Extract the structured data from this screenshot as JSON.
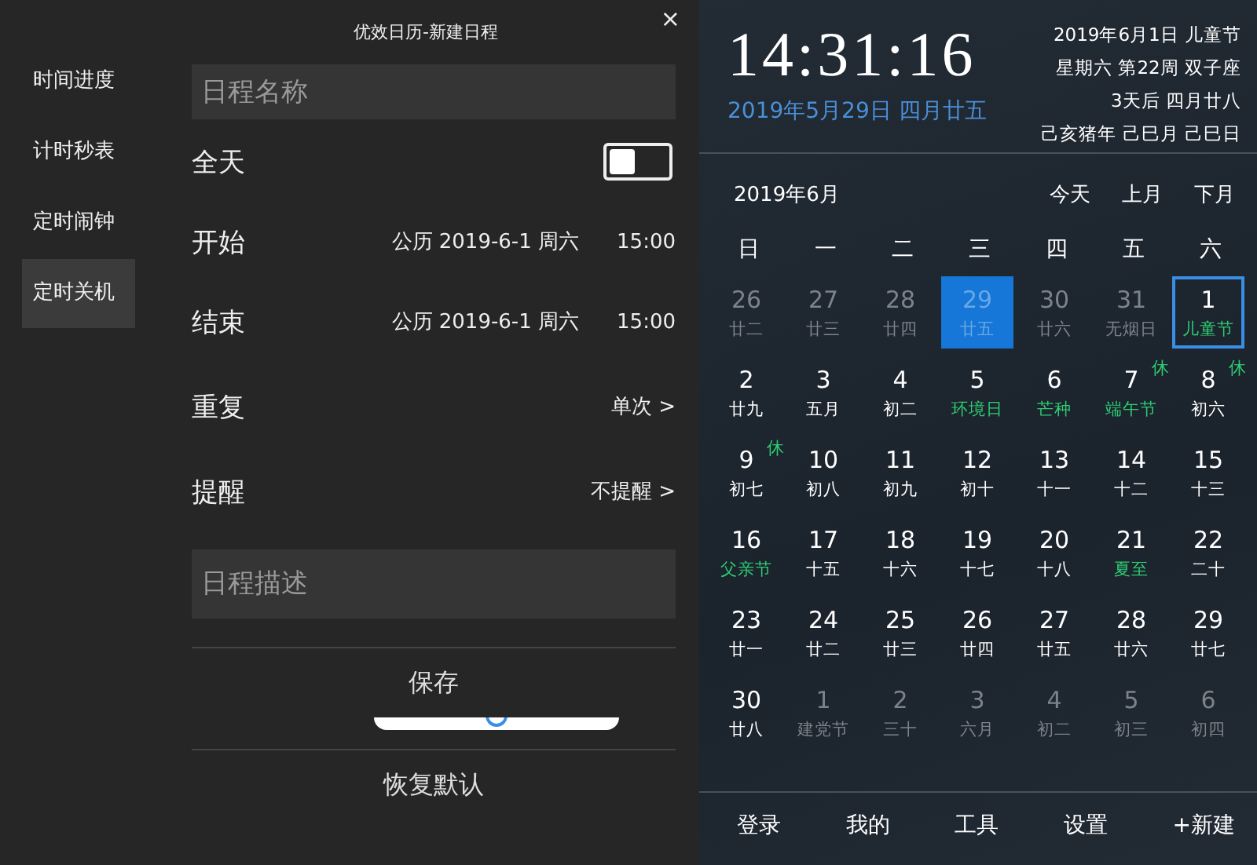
{
  "dialog": {
    "title": "优效日历-新建日程",
    "close": "×",
    "name_field": {
      "placeholder": "日程名称"
    },
    "all_day": {
      "label": "全天",
      "on": false
    },
    "rows": [
      {
        "label": "开始",
        "value": "公历 2019-6-1 周六",
        "time": "15:00"
      },
      {
        "label": "结束",
        "value": "公历 2019-6-1 周六",
        "time": "15:00"
      },
      {
        "label": "重复",
        "value": "单次 >"
      },
      {
        "label": "提醒",
        "value": "不提醒 >"
      }
    ],
    "description_field": {
      "placeholder": "日程描述"
    },
    "save": "保存",
    "slider": {
      "level": 0.5
    },
    "reset": "恢复默认"
  },
  "sidebar": {
    "items": [
      {
        "label": "时间进度",
        "selected": false
      },
      {
        "label": "计时秒表",
        "selected": false
      },
      {
        "label": "定时闹钟",
        "selected": false
      },
      {
        "label": "定时关机",
        "selected": true
      }
    ]
  },
  "calendar": {
    "clock": "14:31:16",
    "lunar_date": "2019年5月29日 四月廿五",
    "info": [
      "2019年6月1日 儿童节",
      "星期六 第22周 双子座",
      "3天后 四月廿八",
      "己亥猪年 己巳月 己巳日"
    ],
    "month": "2019年6月",
    "nav": [
      "今天",
      "上月",
      "下月"
    ],
    "weekdays": [
      "日",
      "一",
      "二",
      "三",
      "四",
      "五",
      "六"
    ],
    "cells": [
      {
        "day": "26",
        "sub": "廿二",
        "muted": true,
        "festival": false,
        "selected": false,
        "current": false
      },
      {
        "day": "27",
        "sub": "廿三",
        "muted": true,
        "festival": false,
        "selected": false,
        "current": false
      },
      {
        "day": "28",
        "sub": "廿四",
        "muted": true,
        "festival": false,
        "selected": false,
        "current": false
      },
      {
        "day": "29",
        "sub": "廿五",
        "muted": true,
        "festival": false,
        "selected": true,
        "current": false
      },
      {
        "day": "30",
        "sub": "廿六",
        "muted": true,
        "festival": false,
        "selected": false,
        "current": false
      },
      {
        "day": "31",
        "sub": "无烟日",
        "muted": true,
        "festival": false,
        "selected": false,
        "current": false
      },
      {
        "day": "1",
        "sub": "儿童节",
        "muted": false,
        "festival": true,
        "selected": false,
        "current": true
      },
      {
        "day": "2",
        "sub": "廿九",
        "muted": false,
        "festival": false,
        "selected": false,
        "current": false
      },
      {
        "day": "3",
        "sub": "五月",
        "muted": false,
        "festival": false,
        "selected": false,
        "current": false
      },
      {
        "day": "4",
        "sub": "初二",
        "muted": false,
        "festival": false,
        "selected": false,
        "current": false
      },
      {
        "day": "5",
        "sub": "环境日",
        "muted": false,
        "festival": true,
        "selected": false,
        "current": false
      },
      {
        "day": "6",
        "sub": "芒种",
        "muted": false,
        "festival": true,
        "selected": false,
        "current": false
      },
      {
        "day": "7",
        "sub": "端午节",
        "muted": false,
        "festival": true,
        "selected": false,
        "current": false,
        "badge": "休"
      },
      {
        "day": "8",
        "sub": "初六",
        "muted": false,
        "festival": false,
        "selected": false,
        "current": false,
        "badge": "休"
      },
      {
        "day": "9",
        "sub": "初七",
        "muted": false,
        "festival": false,
        "selected": false,
        "current": false,
        "badge": "休"
      },
      {
        "day": "10",
        "sub": "初八",
        "muted": false,
        "festival": false,
        "selected": false,
        "current": false
      },
      {
        "day": "11",
        "sub": "初九",
        "muted": false,
        "festival": false,
        "selected": false,
        "current": false
      },
      {
        "day": "12",
        "sub": "初十",
        "muted": false,
        "festival": false,
        "selected": false,
        "current": false
      },
      {
        "day": "13",
        "sub": "十一",
        "muted": false,
        "festival": false,
        "selected": false,
        "current": false
      },
      {
        "day": "14",
        "sub": "十二",
        "muted": false,
        "festival": false,
        "selected": false,
        "current": false
      },
      {
        "day": "15",
        "sub": "十三",
        "muted": false,
        "festival": false,
        "selected": false,
        "current": false
      },
      {
        "day": "16",
        "sub": "父亲节",
        "muted": false,
        "festival": true,
        "selected": false,
        "current": false
      },
      {
        "day": "17",
        "sub": "十五",
        "muted": false,
        "festival": false,
        "selected": false,
        "current": false
      },
      {
        "day": "18",
        "sub": "十六",
        "muted": false,
        "festival": false,
        "selected": false,
        "current": false
      },
      {
        "day": "19",
        "sub": "十七",
        "muted": false,
        "festival": false,
        "selected": false,
        "current": false
      },
      {
        "day": "20",
        "sub": "十八",
        "muted": false,
        "festival": false,
        "selected": false,
        "current": false
      },
      {
        "day": "21",
        "sub": "夏至",
        "muted": false,
        "festival": true,
        "selected": false,
        "current": false
      },
      {
        "day": "22",
        "sub": "二十",
        "muted": false,
        "festival": false,
        "selected": false,
        "current": false
      },
      {
        "day": "23",
        "sub": "廿一",
        "muted": false,
        "festival": false,
        "selected": false,
        "current": false
      },
      {
        "day": "24",
        "sub": "廿二",
        "muted": false,
        "festival": false,
        "selected": false,
        "current": false
      },
      {
        "day": "25",
        "sub": "廿三",
        "muted": false,
        "festival": false,
        "selected": false,
        "current": false
      },
      {
        "day": "26",
        "sub": "廿四",
        "muted": false,
        "festival": false,
        "selected": false,
        "current": false
      },
      {
        "day": "27",
        "sub": "廿五",
        "muted": false,
        "festival": false,
        "selected": false,
        "current": false
      },
      {
        "day": "28",
        "sub": "廿六",
        "muted": false,
        "festival": false,
        "selected": false,
        "current": false
      },
      {
        "day": "29",
        "sub": "廿七",
        "muted": false,
        "festival": false,
        "selected": false,
        "current": false
      },
      {
        "day": "30",
        "sub": "廿八",
        "muted": false,
        "festival": false,
        "selected": false,
        "current": false
      },
      {
        "day": "1",
        "sub": "建党节",
        "muted": true,
        "festival": false,
        "selected": false,
        "current": false
      },
      {
        "day": "2",
        "sub": "三十",
        "muted": true,
        "festival": false,
        "selected": false,
        "current": false
      },
      {
        "day": "3",
        "sub": "六月",
        "muted": true,
        "festival": false,
        "selected": false,
        "current": false
      },
      {
        "day": "4",
        "sub": "初二",
        "muted": true,
        "festival": false,
        "selected": false,
        "current": false
      },
      {
        "day": "5",
        "sub": "初三",
        "muted": true,
        "festival": false,
        "selected": false,
        "current": false
      },
      {
        "day": "6",
        "sub": "初四",
        "muted": true,
        "festival": false,
        "selected": false,
        "current": false
      }
    ],
    "footer": [
      "登录",
      "我的",
      "工具",
      "设置",
      "+新建"
    ]
  }
}
